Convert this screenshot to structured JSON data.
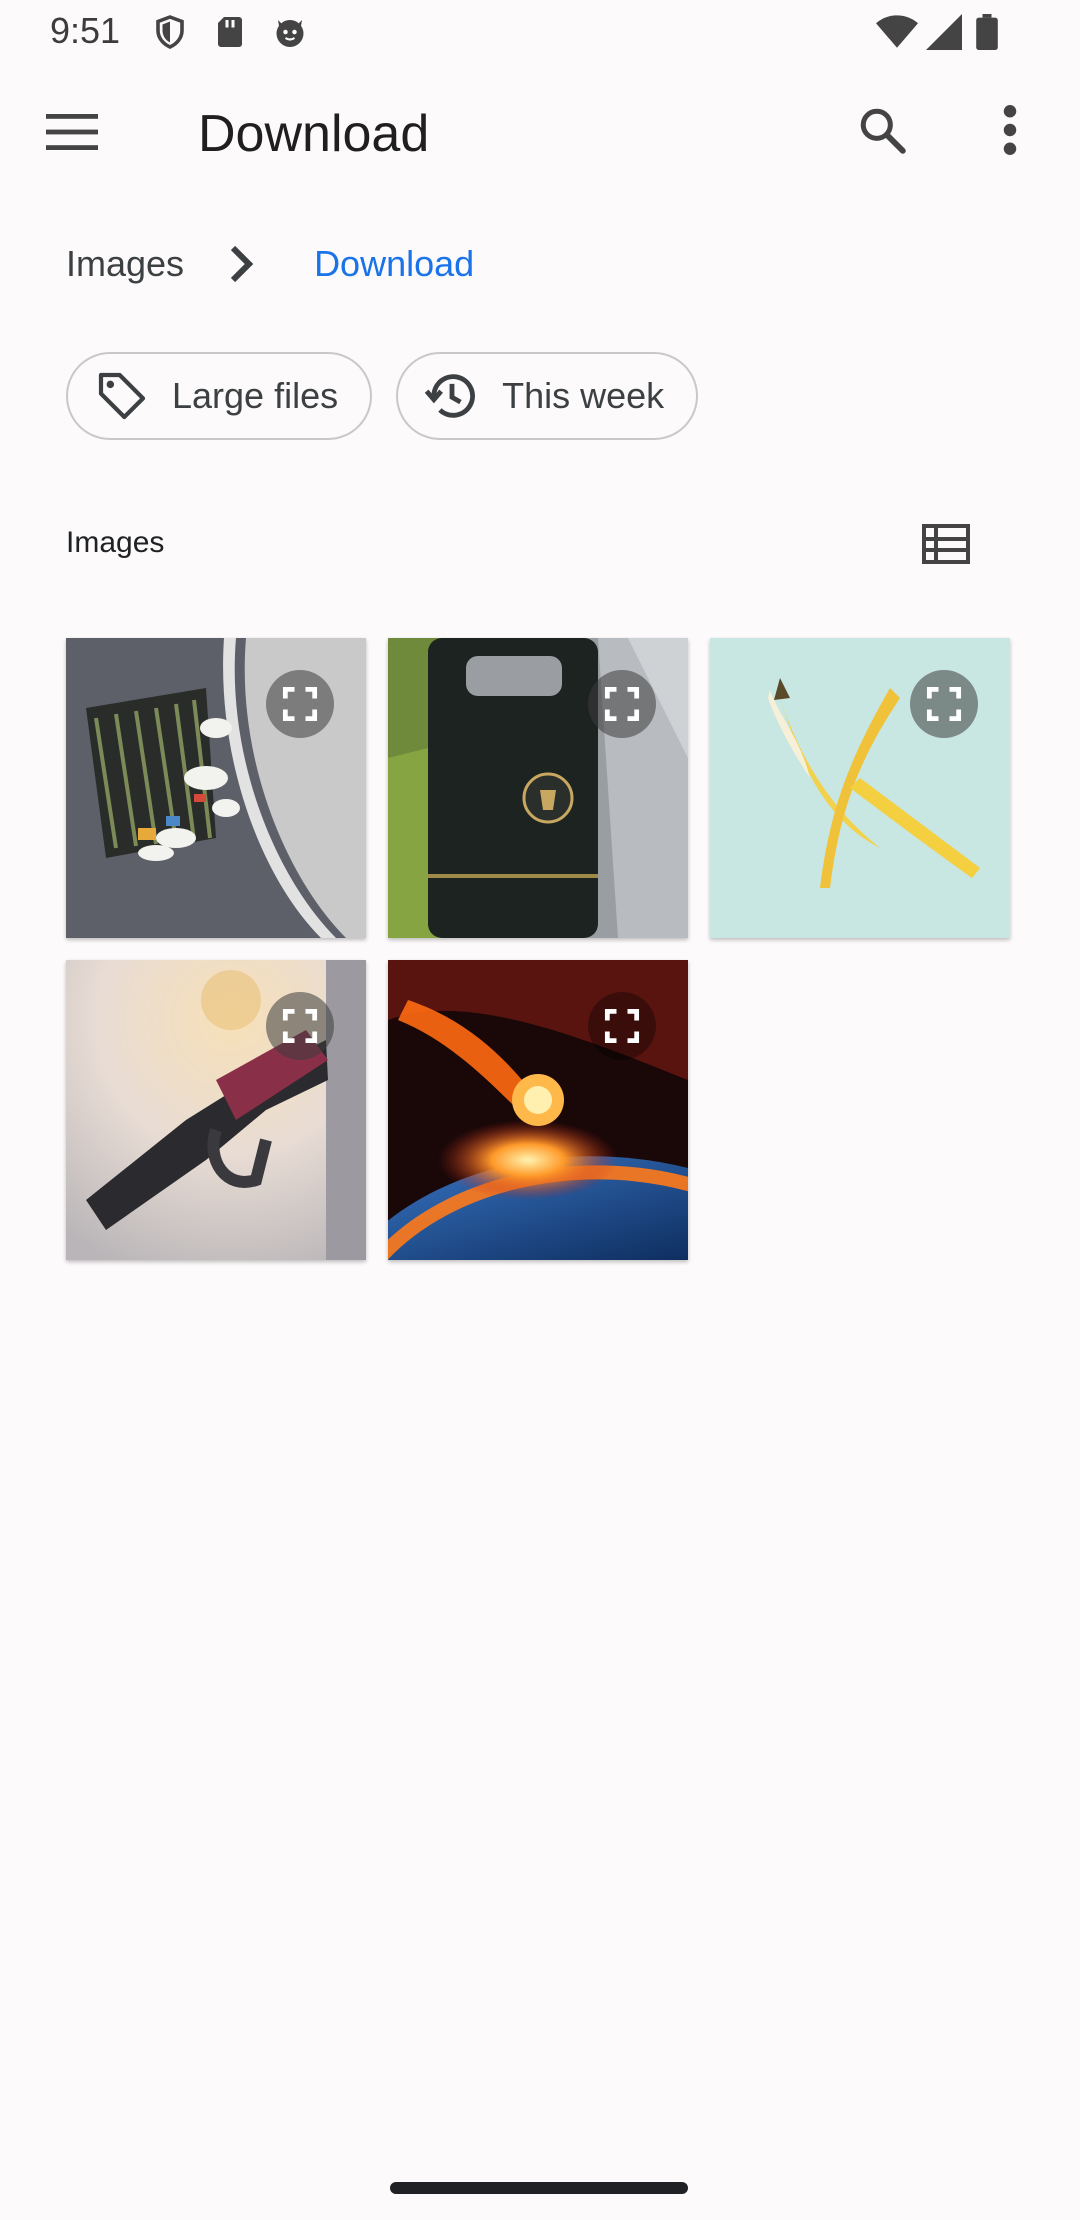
{
  "status_bar": {
    "time": "9:51",
    "icons": [
      "shield-icon",
      "sd-card-icon",
      "cat-face-icon"
    ],
    "right_icons": [
      "wifi-icon",
      "signal-icon",
      "battery-icon"
    ]
  },
  "app_bar": {
    "title": "Download",
    "menu_icon": "hamburger-menu-icon",
    "search_icon": "search-icon",
    "more_icon": "more-vert-icon"
  },
  "breadcrumb": {
    "items": [
      {
        "label": "Images"
      },
      {
        "label": "Download"
      }
    ],
    "separator_icon": "chevron-right-icon",
    "active_color": "#1a73e8"
  },
  "chips": [
    {
      "label": "Large files",
      "icon": "tag-icon"
    },
    {
      "label": "This week",
      "icon": "history-icon"
    }
  ],
  "section": {
    "title": "Images",
    "view_toggle_icon": "list-view-icon"
  },
  "images": [
    {
      "subject": "storm drain with litter",
      "expand_icon": "fullscreen-icon"
    },
    {
      "subject": "black litter bin",
      "expand_icon": "fullscreen-icon"
    },
    {
      "subject": "banana peels",
      "expand_icon": "fullscreen-icon"
    },
    {
      "subject": "fuel pump nozzle",
      "expand_icon": "fullscreen-icon"
    },
    {
      "subject": "meteor hitting earth",
      "expand_icon": "fullscreen-icon"
    }
  ]
}
